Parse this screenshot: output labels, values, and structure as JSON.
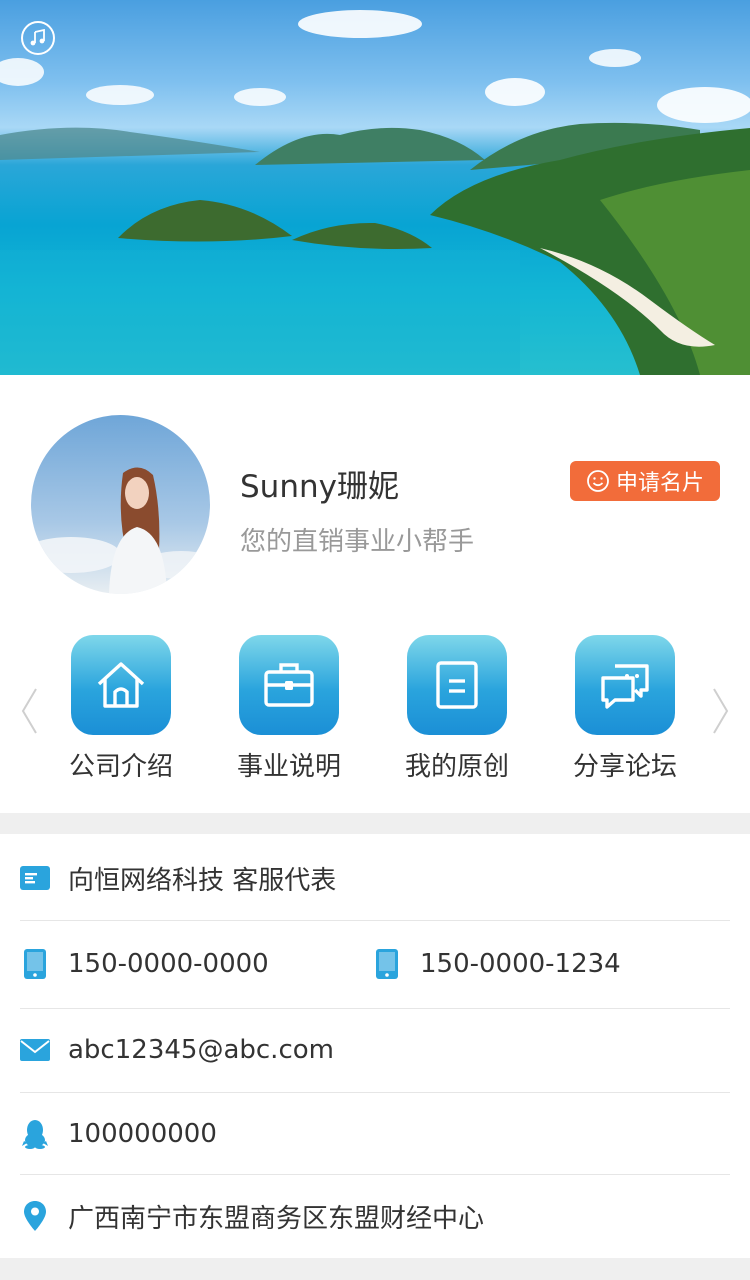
{
  "hero": {
    "music_icon": "music-note-icon"
  },
  "profile": {
    "name": "Sunny珊妮",
    "subtitle": "您的直销事业小帮手",
    "apply_button": {
      "label": "申请名片",
      "icon": "smile-icon",
      "color": "#f26c3a"
    }
  },
  "menu": {
    "items": [
      {
        "label": "公司介绍",
        "icon": "home-icon"
      },
      {
        "label": "事业说明",
        "icon": "briefcase-icon"
      },
      {
        "label": "我的原创",
        "icon": "document-icon"
      },
      {
        "label": "分享论坛",
        "icon": "chat-icon"
      }
    ],
    "gradient": [
      "#7fd7ea",
      "#1b8fd6"
    ]
  },
  "contact": {
    "company": "向恒网络科技 客服代表",
    "phone1": "150-0000-0000",
    "phone2": "150-0000-1234",
    "email": "abc12345@abc.com",
    "qq": "100000000",
    "address": "广西南宁市东盟商务区东盟财经中心"
  },
  "colors": {
    "accent": "#1b9ad6",
    "icon": "#2aa4dd"
  }
}
